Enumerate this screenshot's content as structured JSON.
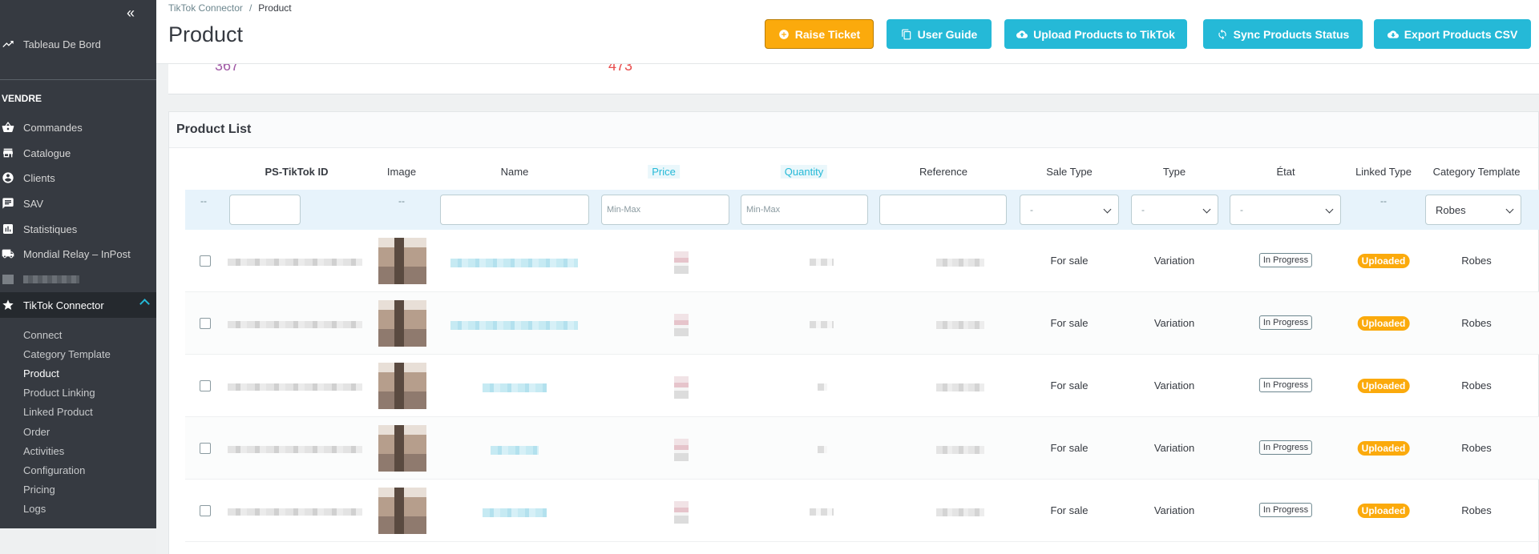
{
  "sidebar": {
    "collapse_icon": "double-chevron-left-icon",
    "dashboard": "Tableau De Bord",
    "section_sell": "VENDRE",
    "items": [
      {
        "label": "Commandes",
        "icon": "basket-icon"
      },
      {
        "label": "Catalogue",
        "icon": "store-icon"
      },
      {
        "label": "Clients",
        "icon": "account-circle-icon"
      },
      {
        "label": "SAV",
        "icon": "chat-icon"
      },
      {
        "label": "Statistiques",
        "icon": "bar-chart-icon"
      },
      {
        "label": "Mondial Relay – InPost",
        "icon": "truck-icon"
      }
    ],
    "tiktok": "TikTok Connector",
    "submenu": [
      "Connect",
      "Category Template",
      "Product",
      "Product Linking",
      "Linked Product",
      "Order",
      "Activities",
      "Configuration",
      "Pricing",
      "Logs"
    ]
  },
  "header": {
    "breadcrumb": [
      "TikTok Connector",
      "Product"
    ],
    "title": "Product",
    "buttons": {
      "raise_ticket": "Raise Ticket",
      "user_guide": "User Guide",
      "upload": "Upload Products to TikTok",
      "sync": "Sync Products Status",
      "export": "Export Products CSV"
    }
  },
  "kpis": [
    "367",
    "473"
  ],
  "product_list": {
    "title": "Product List",
    "columns": {
      "id": "PS-TikTok ID",
      "image": "Image",
      "name": "Name",
      "price": "Price",
      "quantity": "Quantity",
      "reference": "Reference",
      "sale_type": "Sale Type",
      "type": "Type",
      "etat": "État",
      "linked_type": "Linked Type",
      "category_template": "Category Template"
    },
    "filters": {
      "dash": "--",
      "price_placeholder": "Min-Max",
      "qty_placeholder": "Min-Max",
      "select_default": "-",
      "category_selected": "Robes"
    },
    "rows": [
      {
        "sale_type": "For sale",
        "type": "Variation",
        "etat": "In Progress",
        "linked": "Uploaded",
        "category": "Robes"
      },
      {
        "sale_type": "For sale",
        "type": "Variation",
        "etat": "In Progress",
        "linked": "Uploaded",
        "category": "Robes"
      },
      {
        "sale_type": "For sale",
        "type": "Variation",
        "etat": "In Progress",
        "linked": "Uploaded",
        "category": "Robes"
      },
      {
        "sale_type": "For sale",
        "type": "Variation",
        "etat": "In Progress",
        "linked": "Uploaded",
        "category": "Robes"
      },
      {
        "sale_type": "For sale",
        "type": "Variation",
        "etat": "In Progress",
        "linked": "Uploaded",
        "category": "Robes"
      }
    ]
  },
  "colors": {
    "accent": "#25b9d7",
    "warning": "#fbaa0c",
    "sidebar": "#363a41",
    "kpi_purple": "#a15ba6",
    "kpi_red": "#e84d4d"
  }
}
